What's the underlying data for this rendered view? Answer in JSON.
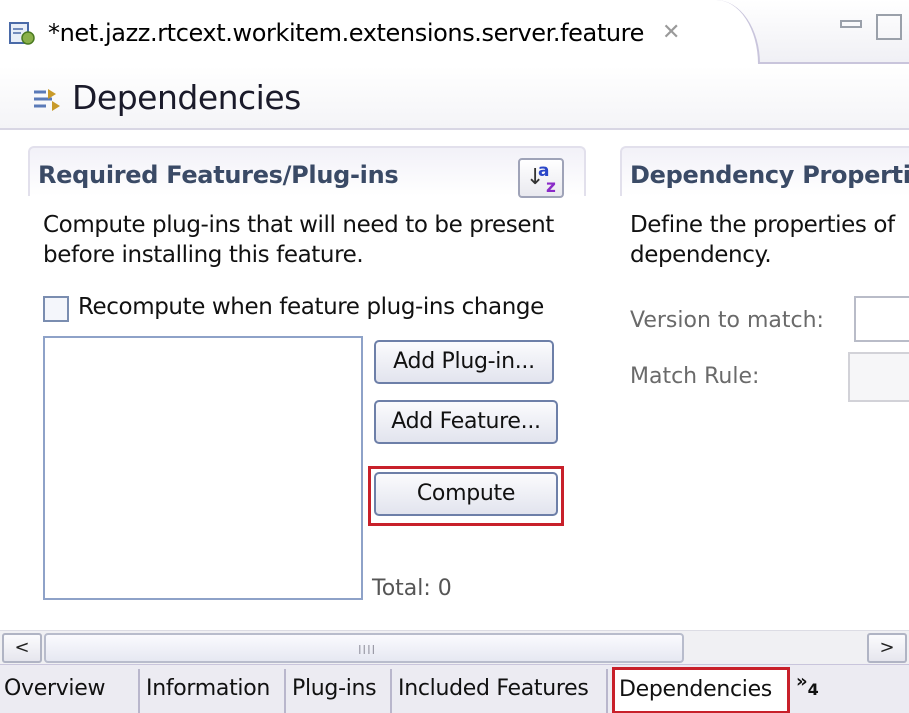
{
  "editor_tab": {
    "title": "*net.jazz.rtcext.workitem.extensions.server.feature",
    "close_glyph": "✕",
    "icon": "feature-manifest-icon"
  },
  "window_controls": {
    "minimize_icon": "minimize-icon",
    "maximize_icon": "maximize-icon"
  },
  "header": {
    "title": "Dependencies",
    "icon": "dependencies-icon"
  },
  "required_section": {
    "title": "Required Features/Plug-ins",
    "sort_icon": "sort-alphabetical-icon",
    "description": "Compute plug-ins that will need to be present before installing this feature.",
    "recompute_label": "Recompute when feature plug-ins change",
    "recompute_checked": false,
    "add_plugin_label": "Add Plug-in...",
    "add_feature_label": "Add Feature...",
    "compute_label": "Compute",
    "total_label": "Total: 0"
  },
  "dependency_section": {
    "title": "Dependency Properties",
    "description": "Define the properties of\ndependency.",
    "version_label": "Version to match:",
    "rule_label": "Match Rule:"
  },
  "scrollbar": {
    "left_glyph": "<",
    "right_glyph": ">",
    "grip": "IIII"
  },
  "page_tabs": {
    "overview": "Overview",
    "information": "Information",
    "plugins": "Plug-ins",
    "included": "Included Features",
    "dependencies": "Dependencies",
    "more_glyph": "»",
    "more_count": "4"
  },
  "colors": {
    "highlight": "#c8202a",
    "section_title": "#3a4a66"
  }
}
